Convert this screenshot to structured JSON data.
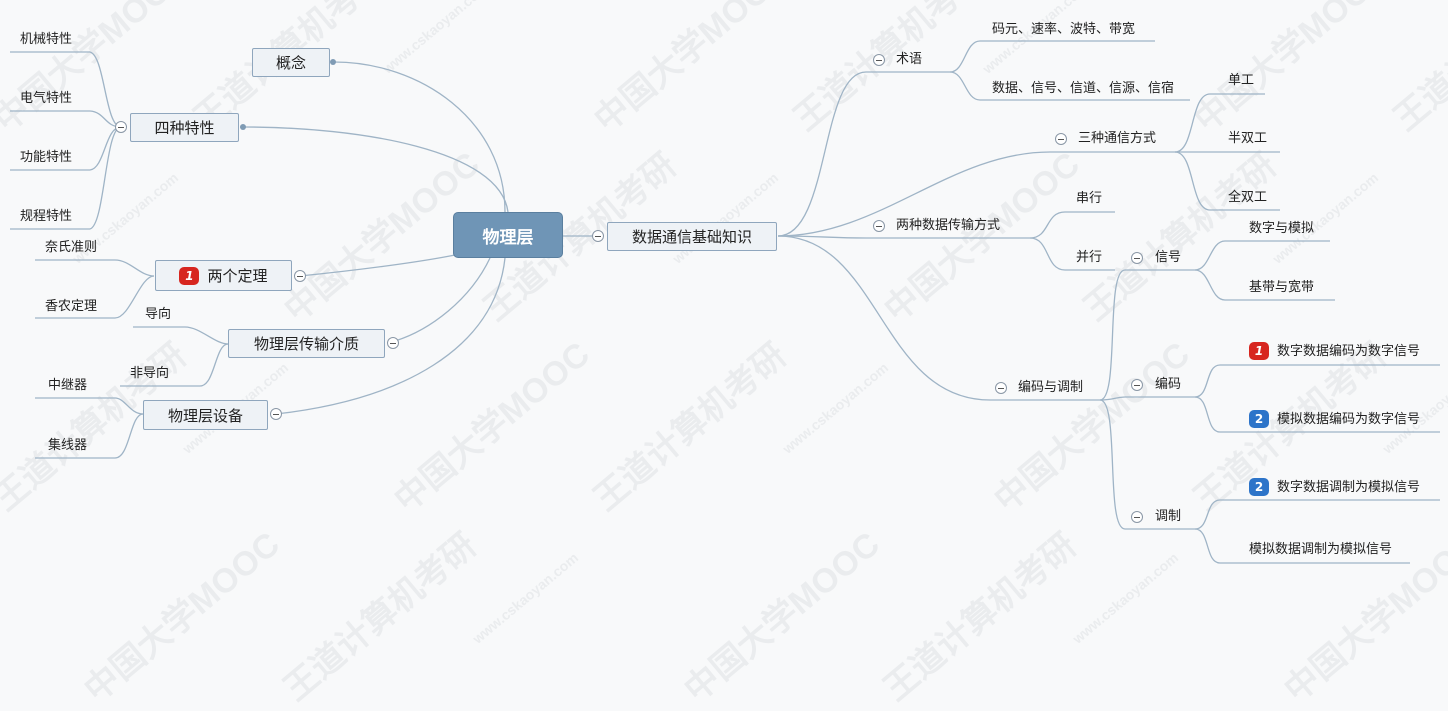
{
  "root": "物理层",
  "left": {
    "concept": "概念",
    "four_props": {
      "label": "四种特性",
      "items": [
        "机械特性",
        "电气特性",
        "功能特性",
        "规程特性"
      ]
    },
    "theorems": {
      "label": "两个定理",
      "badge": "1",
      "items": [
        "奈氏准则",
        "香农定理"
      ]
    },
    "media": {
      "label": "物理层传输介质",
      "items": [
        "导向",
        "非导向"
      ]
    },
    "devices": {
      "label": "物理层设备",
      "items": [
        "中继器",
        "集线器"
      ]
    }
  },
  "right": {
    "label": "数据通信基础知识",
    "terms": {
      "label": "术语",
      "items": [
        "码元、速率、波特、带宽",
        "数据、信号、信道、信源、信宿"
      ]
    },
    "modes": {
      "label": "三种通信方式",
      "items": [
        "单工",
        "半双工",
        "全双工"
      ]
    },
    "transmission": {
      "label": "两种数据传输方式",
      "items": [
        "串行",
        "并行"
      ]
    },
    "coding": {
      "label": "编码与调制",
      "signal": {
        "label": "信号",
        "items": [
          "数字与模拟",
          "基带与宽带"
        ]
      },
      "encoding": {
        "label": "编码",
        "items": [
          {
            "badge": "1",
            "text": "数字数据编码为数字信号"
          },
          {
            "badge": "2",
            "text": "模拟数据编码为数字信号"
          }
        ]
      },
      "modulation": {
        "label": "调制",
        "items": [
          {
            "badge": "2",
            "text": "数字数据调制为模拟信号"
          },
          {
            "badge": "",
            "text": "模拟数据调制为模拟信号"
          }
        ]
      }
    }
  },
  "watermarks": [
    "中国大学MOOC",
    "王道计算机考研",
    "www.cskaoyan.com"
  ],
  "colors": {
    "root_fill": "#6f95b6",
    "node_fill": "#eef2f6",
    "line": "#9fb4c6",
    "badge_red": "#d7261f",
    "badge_blue": "#2d74c9"
  }
}
